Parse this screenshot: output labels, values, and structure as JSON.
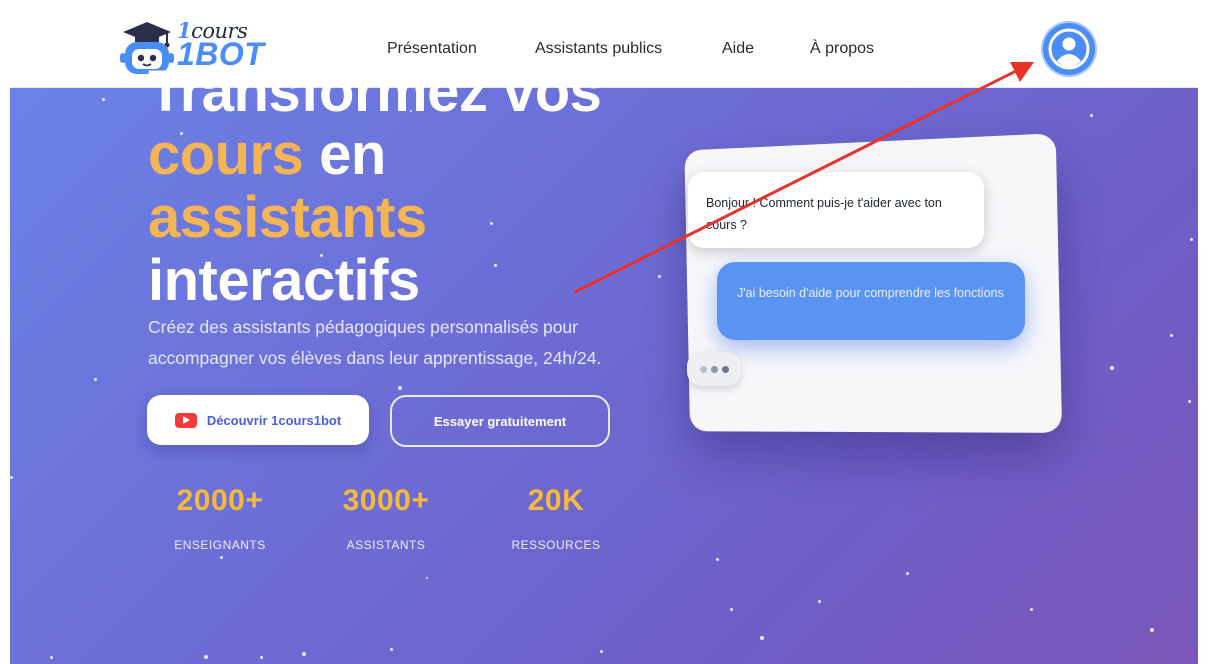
{
  "header": {
    "logo": {
      "line1_num": "1",
      "line1_word": "cours",
      "line2": "1BOT"
    },
    "nav": [
      {
        "label": "Présentation"
      },
      {
        "label": "Assistants publics"
      },
      {
        "label": "Aide"
      },
      {
        "label": "À propos"
      }
    ],
    "avatar_icon": "user-avatar-icon"
  },
  "hero": {
    "headline": {
      "line1": "Transformez vos",
      "line2_highlight": "cours",
      "line2_rest": " en",
      "line3_highlight": "assistants",
      "line4": "interactifs"
    },
    "subtitle": "Créez des assistants pédagogiques personnalisés pour accompagner vos élèves dans leur apprentissage, 24h/24.",
    "primary_button": {
      "label": "Découvrir 1cours1bot",
      "icon": "youtube-play-icon"
    },
    "secondary_button": {
      "label": "Essayer gratuitement"
    },
    "stats": [
      {
        "value": "2000+",
        "label": "ENSEIGNANTS"
      },
      {
        "value": "3000+",
        "label": "ASSISTANTS"
      },
      {
        "value": "20K",
        "label": "RESSOURCES"
      }
    ]
  },
  "chat_preview": {
    "bot_message": "Bonjour ! Comment puis-je t'aider avec ton cours ?",
    "user_message": "J'ai besoin d'aide pour comprendre les fonctions",
    "typing_indicator": "typing-dots-icon"
  },
  "colors": {
    "accent_blue": "#4a8df6",
    "highlight_orange": "#f3b556",
    "stat_yellow": "#f6b93b",
    "annotation_arrow": "#e8332a"
  }
}
